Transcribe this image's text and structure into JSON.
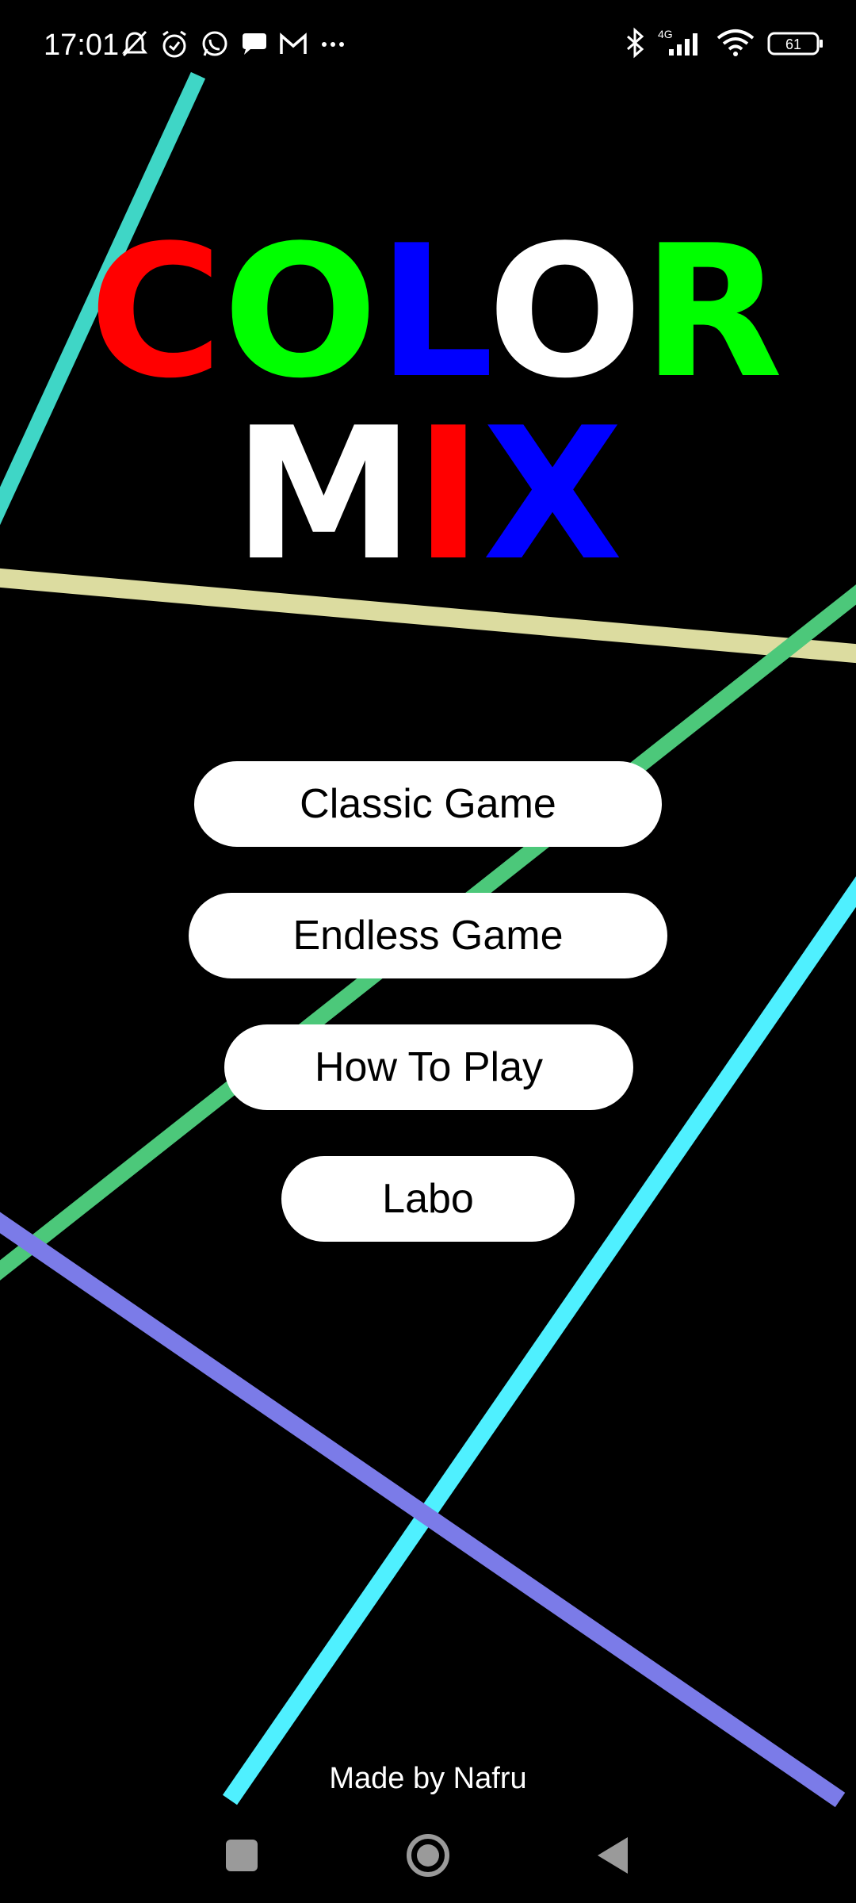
{
  "status_bar": {
    "time": "17:01",
    "network": "4G",
    "battery": "61"
  },
  "title": {
    "row1": [
      {
        "char": "C",
        "color": "#ff0000"
      },
      {
        "char": "O",
        "color": "#00ff00"
      },
      {
        "char": "L",
        "color": "#0000ff"
      },
      {
        "char": "O",
        "color": "#ffffff"
      },
      {
        "char": "R",
        "color": "#00ff00"
      }
    ],
    "row2": [
      {
        "char": "M",
        "color": "#ffffff"
      },
      {
        "char": "I",
        "color": "#ff0000"
      },
      {
        "char": "X",
        "color": "#0000ff"
      }
    ]
  },
  "menu": {
    "classic": "Classic Game",
    "endless": "Endless Game",
    "how_to_play": "How To Play",
    "labo": "Labo"
  },
  "footer": {
    "credit": "Made by Nafru"
  },
  "colors": {
    "line_teal": "#3fd6c6",
    "line_yellow": "#dcdca0",
    "line_green": "#4cc87a",
    "line_cyan": "#4ff0ff",
    "line_purple": "#7b7be8"
  }
}
